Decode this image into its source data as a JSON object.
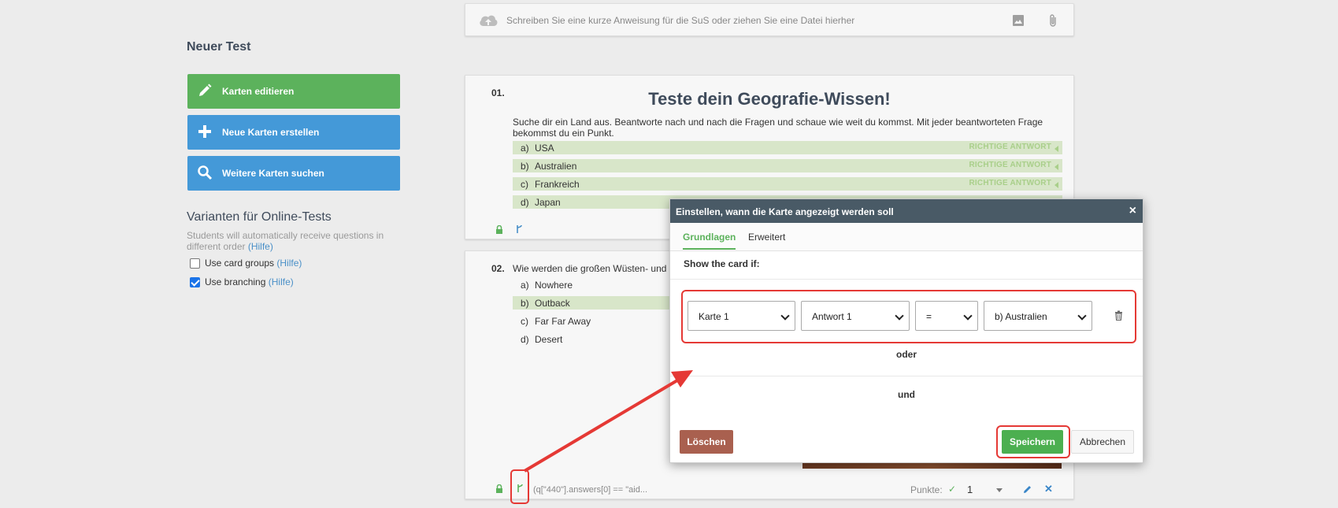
{
  "sidebar": {
    "title": "Neuer Test",
    "buttons": {
      "edit": "Karten editieren",
      "create": "Neue Karten erstellen",
      "search": "Weitere Karten suchen"
    },
    "variants": {
      "title": "Varianten für Online-Tests",
      "desc": "Students will automatically receive questions in different order",
      "help": "(Hilfe)",
      "options": [
        {
          "label": "Use card groups",
          "help": "(Hilfe)",
          "checked": false
        },
        {
          "label": "Use branching",
          "help": "(Hilfe)",
          "checked": true
        }
      ]
    }
  },
  "instruction": {
    "placeholder": "Schreiben Sie eine kurze Anweisung für die SuS oder ziehen Sie eine Datei hierher"
  },
  "card1": {
    "number": "01.",
    "heading": "Teste dein Geografie-Wissen!",
    "text": "Suche dir ein Land aus. Beantworte nach und nach die Fragen und schaue wie weit du kommst. Mit jeder beantworteten Frage bekommst du ein Punkt.",
    "correct_mark": "RICHTIGE ANTWORT",
    "answers": [
      {
        "letter": "a)",
        "text": "USA",
        "correct": true
      },
      {
        "letter": "b)",
        "text": "Australien",
        "correct": true
      },
      {
        "letter": "c)",
        "text": "Frankreich",
        "correct": true
      },
      {
        "letter": "d)",
        "text": "Japan",
        "correct": true
      }
    ],
    "branch_icon": "branch-icon"
  },
  "card2": {
    "number": "02.",
    "question": "Wie werden die großen Wüsten- und",
    "answers": [
      {
        "letter": "a)",
        "text": "Nowhere",
        "correct": false
      },
      {
        "letter": "b)",
        "text": "Outback",
        "correct": true
      },
      {
        "letter": "c)",
        "text": "Far Far Away",
        "correct": false
      },
      {
        "letter": "d)",
        "text": "Desert",
        "correct": false
      }
    ],
    "condition": "(q[\"440\"].answers[0] == \"aid...",
    "points_label": "Punkte:",
    "points_value": "1"
  },
  "modal": {
    "title": "Einstellen, wann die Karte angezeigt werden soll",
    "close": "×",
    "tabs": [
      "Grundlagen",
      "Erweitert"
    ],
    "show_if": "Show the card if:",
    "selects": {
      "card": "Karte 1",
      "answer": "Antwort 1",
      "operator": "=",
      "value": "b) Australien"
    },
    "or_label": "oder",
    "and_label": "und",
    "delete": "Löschen",
    "save": "Speichern",
    "cancel": "Abbrechen"
  },
  "colors": {
    "green": "#5cb25c",
    "blue": "#4499d8",
    "modal_header": "#495a66",
    "annotation_red": "#e53935",
    "correct_bg": "#d8e6c9"
  }
}
